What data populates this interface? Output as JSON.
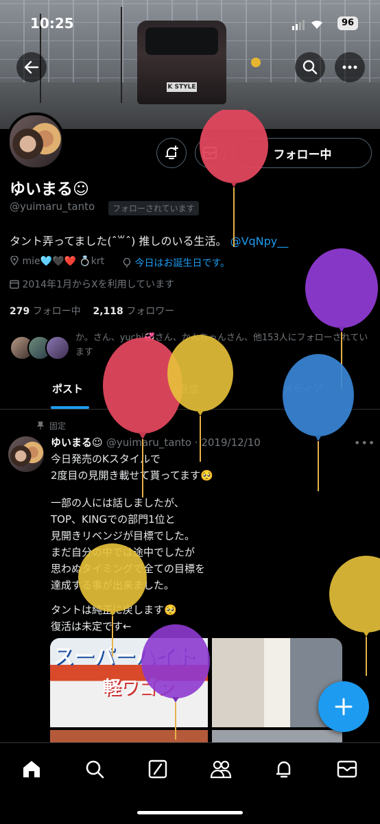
{
  "status_bar": {
    "time": "10:25",
    "battery": "96"
  },
  "banner": {
    "plate_text": "K STYLE"
  },
  "profile": {
    "name": "ゆいまる☺︎",
    "handle": "@yuimaru_tanto",
    "follows_you": "フォローされています",
    "follow_button": "フォロー中",
    "bio_text": "タント弄ってました(ˆ꒳ˆ) 推しのいる生活。",
    "bio_link": "@VqNpy__",
    "location": "mie🩵🖤❤️ 💍krt",
    "birthday": "今日はお誕生日です。",
    "joined": "2014年1月からXを利用しています",
    "following_count": "279",
    "following_label": "フォロー中",
    "followers_count": "2,118",
    "followers_label": "フォロワー",
    "followed_by": "か。さん、yuchi💞さん、かんちゃんさん、他153人にフォローされています"
  },
  "tabs": [
    {
      "label": "ポスト"
    },
    {
      "label": "返信"
    },
    {
      "label": "メディア"
    }
  ],
  "post": {
    "pinned_label": "固定",
    "author": "ゆいまる☺︎",
    "meta": "@yuimaru_tanto · 2019/12/10",
    "lines": [
      "今日発売のKスタイルで",
      "2度目の見開き載せて貰ってます🥺",
      "",
      "一部の人には話しましたが、",
      "TOP、KINGでの部門1位と",
      "見開きリベンジが目標でした。",
      "まだ自分の中では途中でしたが",
      "思わぬタイミングで全ての目標を",
      "達成する事が出来ました。",
      "",
      "タントは純正に戻します🥺",
      "復活は未定です←"
    ],
    "image_text_1": "スーパーハイト",
    "image_text_2": "軽ワゴン"
  },
  "colors": {
    "accent": "#1d9bf0",
    "background": "#000000",
    "secondary_text": "#71767b"
  },
  "icons": {
    "back": "arrow-left-icon",
    "search": "search-icon",
    "more": "more-icon",
    "notify": "bell-plus-icon",
    "message": "envelope-icon",
    "fab": "plus-icon",
    "nav": [
      "home-icon",
      "search-icon",
      "grok-icon",
      "communities-icon",
      "bell-icon",
      "mail-icon"
    ]
  }
}
